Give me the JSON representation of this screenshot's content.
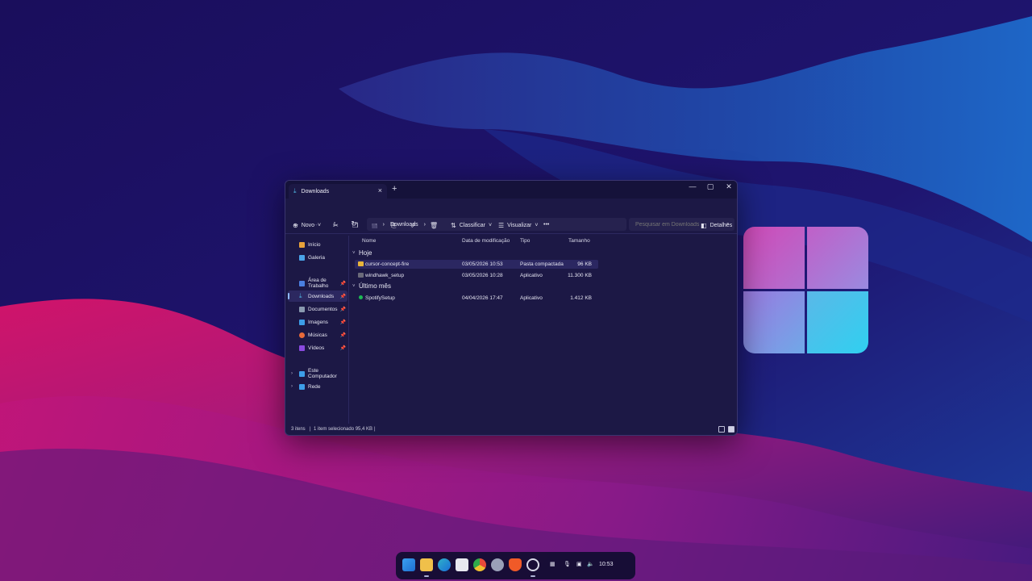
{
  "window": {
    "tab_title": "Downloads",
    "tab_close": "×",
    "new_tab": "+",
    "minimize": "—",
    "maximize": "▢",
    "close": "✕"
  },
  "address": {
    "path": [
      "Downloads"
    ],
    "separator": "›",
    "search_placeholder": "Pesquisar em Downloads"
  },
  "toolbar": {
    "new_label": "Novo",
    "sort_label": "Classificar",
    "view_label": "Visualizar",
    "more_label": "•••",
    "details_label": "Detalhes"
  },
  "sidebar": {
    "items": [
      {
        "label": "Início",
        "icon": "home-icon",
        "color": "#e8a23a"
      },
      {
        "label": "Galeria",
        "icon": "gallery-icon",
        "color": "#4aa3e8"
      },
      {
        "label": "Área de Trabalho",
        "icon": "desktop-icon",
        "color": "#4a7fe0",
        "pinned": true
      },
      {
        "label": "Downloads",
        "icon": "download-icon",
        "color": "#4fb3e0",
        "pinned": true,
        "active": true
      },
      {
        "label": "Documentos",
        "icon": "documents-icon",
        "color": "#8a9ab0",
        "pinned": true
      },
      {
        "label": "Imagens",
        "icon": "images-icon",
        "color": "#3d9ee8",
        "pinned": true
      },
      {
        "label": "Músicas",
        "icon": "music-icon",
        "color": "#e86a3a",
        "pinned": true
      },
      {
        "label": "Vídeos",
        "icon": "videos-icon",
        "color": "#8a4ae0",
        "pinned": true
      },
      {
        "label": "Este Computador",
        "icon": "computer-icon",
        "color": "#3d9ee8"
      },
      {
        "label": "Rede",
        "icon": "network-icon",
        "color": "#3d9ee8"
      }
    ]
  },
  "columns": [
    "Nome",
    "Data de modificação",
    "Tipo",
    "Tamanho"
  ],
  "groups": [
    {
      "label": "Hoje",
      "files": [
        {
          "name": "cursor-concept-fire",
          "date": "03/05/2026 10:53",
          "type": "Pasta compactada",
          "size": "96 KB",
          "icon": "zip-folder-icon",
          "color": "#e8b43a",
          "selected": true
        },
        {
          "name": "windhawk_setup",
          "date": "03/05/2026 10:28",
          "type": "Aplicativo",
          "size": "11.300 KB",
          "icon": "app-icon",
          "color": "#6a6a7a"
        }
      ]
    },
    {
      "label": "Último mês",
      "files": [
        {
          "name": "SpotifySetup",
          "date": "04/04/2026 17:47",
          "type": "Aplicativo",
          "size": "1.412 KB",
          "icon": "spotify-icon",
          "color": "#1db954"
        }
      ]
    }
  ],
  "status": {
    "count": "3 itens",
    "selection": "1 item selecionado 95,4 KB"
  },
  "taskbar": {
    "clock": "10:53",
    "apps": [
      {
        "name": "start-icon",
        "color": "#3aa0f0"
      },
      {
        "name": "file-explorer-icon",
        "color": "#f0c04a"
      },
      {
        "name": "edge-icon",
        "color": "#2fb0c8"
      },
      {
        "name": "store-icon",
        "color": "#e8e8f0"
      },
      {
        "name": "chrome-icon",
        "color": "#e84a3a"
      },
      {
        "name": "settings-icon",
        "color": "#9aa0b8"
      },
      {
        "name": "brave-icon",
        "color": "#f05a28"
      },
      {
        "name": "clock-app-icon",
        "color": "#d8d8e8"
      }
    ]
  }
}
